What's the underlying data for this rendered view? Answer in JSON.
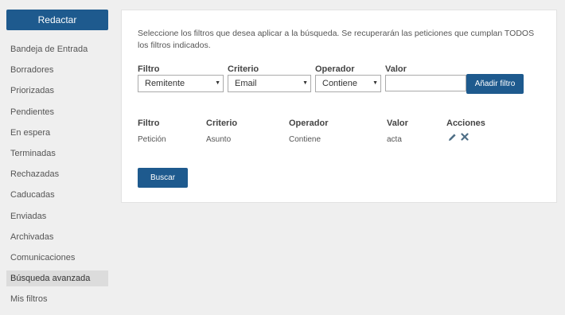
{
  "sidebar": {
    "compose_label": "Redactar",
    "items": [
      {
        "label": "Bandeja de Entrada"
      },
      {
        "label": "Borradores"
      },
      {
        "label": "Priorizadas"
      },
      {
        "label": "Pendientes"
      },
      {
        "label": "En espera"
      },
      {
        "label": "Terminadas"
      },
      {
        "label": "Rechazadas"
      },
      {
        "label": "Caducadas"
      },
      {
        "label": "Enviadas"
      },
      {
        "label": "Archivadas"
      },
      {
        "label": "Comunicaciones"
      },
      {
        "label": "Búsqueda avanzada"
      },
      {
        "label": "Mis filtros"
      }
    ]
  },
  "panel": {
    "intro": "Seleccione los filtros que desea aplicar a la búsqueda. Se recuperarán las peticiones que cumplan TODOS los filtros indicados.",
    "form": {
      "filtro_label": "Filtro",
      "filtro_value": "Remitente",
      "criterio_label": "Criterio",
      "criterio_value": "Email",
      "operador_label": "Operador",
      "operador_value": "Contiene",
      "valor_label": "Valor",
      "valor_value": "",
      "add_label": "Añadir filtro"
    },
    "table": {
      "headers": [
        "Filtro",
        "Criterio",
        "Operador",
        "Valor",
        "Acciones"
      ],
      "rows": [
        [
          "Petición",
          "Asunto",
          "Contiene",
          "acta"
        ]
      ]
    },
    "search_label": "Buscar"
  }
}
